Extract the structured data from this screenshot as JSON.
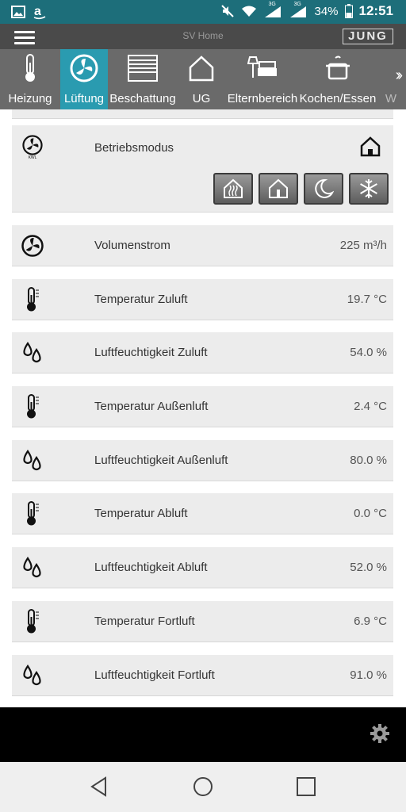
{
  "status_bar": {
    "battery": "34%",
    "time": "12:51",
    "network_1": "3G",
    "network_2": "3G"
  },
  "header": {
    "title": "SV Home",
    "brand": "JUNG"
  },
  "tabs": [
    {
      "label": "Heizung",
      "icon": "thermometer-icon",
      "active": false
    },
    {
      "label": "Lüftung",
      "icon": "fan-icon",
      "active": true
    },
    {
      "label": "Beschattung",
      "icon": "blinds-icon",
      "active": false
    },
    {
      "label": "UG",
      "icon": "house-icon",
      "active": false
    },
    {
      "label": "Elternbereich",
      "icon": "bed-lamp-icon",
      "active": false
    },
    {
      "label": "Kochen/Essen",
      "icon": "cooking-pot-icon",
      "active": false
    },
    {
      "label": "W",
      "icon": "chevron-right-icon",
      "active": false
    }
  ],
  "mode": {
    "label": "Betriebsmodus",
    "fan_caption": "KWL",
    "current_icon": "house-icon",
    "buttons": [
      "house-heat-icon",
      "house-person-icon",
      "moon-icon",
      "snowflake-icon"
    ]
  },
  "rows": [
    {
      "label": "Volumenstrom",
      "value": "225 m³/h",
      "icon": "fan-icon"
    },
    {
      "label": "Temperatur Zuluft",
      "value": "19.7 °C",
      "icon": "thermometer-icon"
    },
    {
      "label": "Luftfeuchtigkeit Zuluft",
      "value": "54.0 %",
      "icon": "humidity-drops-icon"
    },
    {
      "label": "Temperatur Außenluft",
      "value": "2.4 °C",
      "icon": "thermometer-icon"
    },
    {
      "label": "Luftfeuchtigkeit Außenluft",
      "value": "80.0 %",
      "icon": "humidity-drops-icon"
    },
    {
      "label": "Temperatur Abluft",
      "value": "0.0 °C",
      "icon": "thermometer-icon"
    },
    {
      "label": "Luftfeuchtigkeit Abluft",
      "value": "52.0 %",
      "icon": "humidity-drops-icon"
    },
    {
      "label": "Temperatur Fortluft",
      "value": "6.9 °C",
      "icon": "thermometer-icon"
    },
    {
      "label": "Luftfeuchtigkeit Fortluft",
      "value": "91.0 %",
      "icon": "humidity-drops-icon"
    }
  ],
  "colors": {
    "status_bar": "#1d6e7a",
    "active_tab": "#2a9bb0",
    "tab_bar": "#6a6a6a",
    "card": "#ececec"
  }
}
